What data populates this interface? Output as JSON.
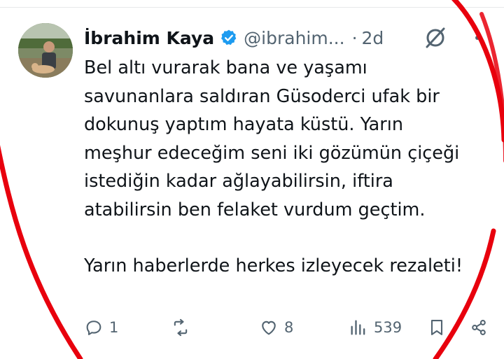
{
  "tweet": {
    "author_name": "İbrahim Kaya",
    "handle": "@ibrahim...",
    "dot": "·",
    "time": "2d",
    "paragraphs": [
      "Bel altı vurarak bana ve yaşamı savunanlara saldıran Güsoderci ufak bir dokunuş yaptım hayata küstü. Yarın meşhur edeceğim seni iki gözümün çiçeği istediğin kadar ağlayabilirsin, iftira atabilirsin ben felaket vurdum geçtim.",
      "Yarın haberlerde herkes izleyecek rezaleti!"
    ]
  },
  "actions": {
    "reply_count": "1",
    "retweet_count": "",
    "like_count": "8",
    "view_count": "539"
  },
  "icons": {
    "verified": "verified-badge-icon",
    "grok": "grok-icon",
    "more": "more-icon",
    "reply": "reply-icon",
    "retweet": "retweet-icon",
    "like": "heart-icon",
    "views": "views-icon",
    "bookmark": "bookmark-icon",
    "share": "share-icon"
  },
  "colors": {
    "text": "#0f1419",
    "secondary": "#536471",
    "verified": "#1d9bf0",
    "annotation": "#e8000d"
  }
}
